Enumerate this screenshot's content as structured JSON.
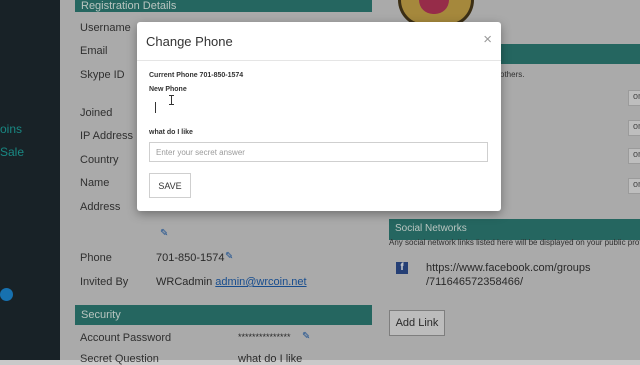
{
  "sidebar": {
    "items": [
      {
        "label": "oins"
      },
      {
        "label": "Sale"
      }
    ]
  },
  "registration": {
    "header": "Registration Details",
    "fields": [
      {
        "label": "Username"
      },
      {
        "label": "Email"
      },
      {
        "label": "Skype ID"
      },
      {
        "label": "Joined"
      },
      {
        "label": "IP Address"
      },
      {
        "label": "Country"
      },
      {
        "label": "Name"
      },
      {
        "label": "Address"
      }
    ],
    "phone_label": "Phone",
    "phone_value": "701-850-1574",
    "invited_label": "Invited By",
    "invited_value": "WRCadmin",
    "invited_email": "admin@wrcoin.net"
  },
  "security": {
    "header": "Security",
    "password_label": "Account Password",
    "password_value": "***************",
    "secret_question_label": "Secret Question",
    "secret_question_value": "what do I like"
  },
  "right_panel": {
    "others_text": "others.",
    "pill_text": "on"
  },
  "social": {
    "header": "Social Networks",
    "description": "Any social network links listed here will be displayed on your public profi",
    "link_line1": "https://www.facebook.com/groups",
    "link_line2": "/711646572358466/",
    "add_link_label": "Add Link"
  },
  "modal": {
    "title": "Change Phone",
    "close_symbol": "×",
    "current_phone_label": "Current Phone 701-850-1574",
    "new_phone_label": "New Phone",
    "new_phone_value": "",
    "secret_label": "what do I like",
    "secret_placeholder": "Enter your secret answer",
    "save_label": "SAVE"
  }
}
